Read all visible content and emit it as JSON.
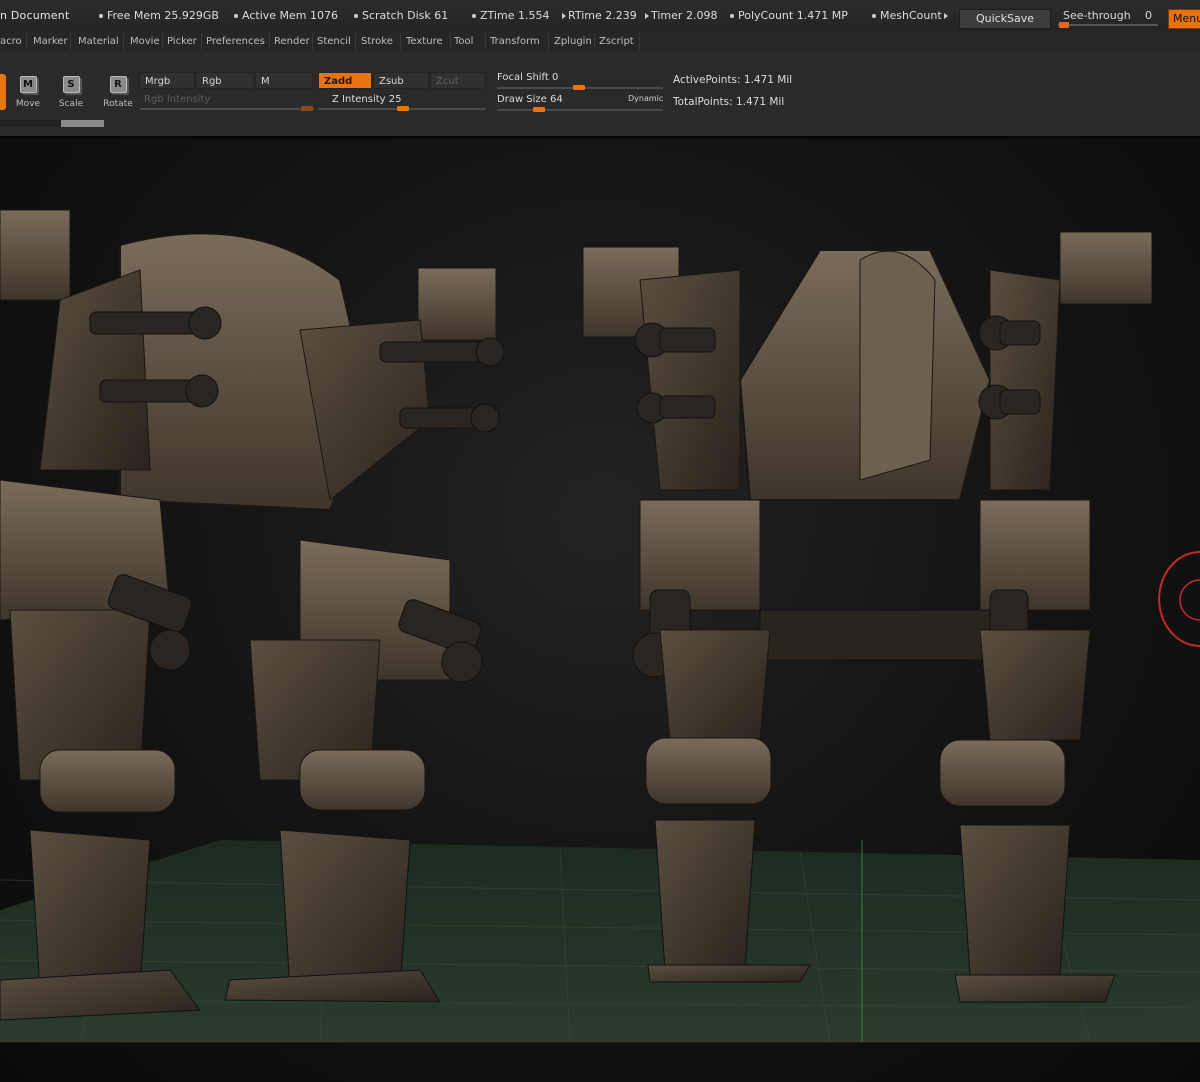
{
  "status": {
    "title_fragment": "n Document",
    "items": [
      {
        "label": "Free Mem",
        "value": "25.929GB",
        "marker": "dot"
      },
      {
        "label": "Active Mem",
        "value": "1076",
        "marker": "dot"
      },
      {
        "label": "Scratch Disk",
        "value": "61",
        "marker": "dot"
      },
      {
        "label": "ZTime",
        "value": "1.554",
        "marker": "dot"
      },
      {
        "label": "RTime",
        "value": "2.239",
        "marker": "tri"
      },
      {
        "label": "Timer",
        "value": "2.098",
        "marker": "tri"
      },
      {
        "label": "PolyCount",
        "value": "1.471 MP",
        "marker": "dot"
      },
      {
        "label": "MeshCount",
        "value": "",
        "marker": "dot"
      }
    ],
    "quicksave": "QuickSave",
    "see_through_label": "See-through",
    "see_through_value": "0",
    "menus_label": "Menus"
  },
  "menubar": [
    "acro",
    "Marker",
    "Material",
    "Movie",
    "Picker",
    "Preferences",
    "Render",
    "Stencil",
    "Stroke",
    "Texture",
    "Tool",
    "Transform",
    "Zplugin",
    "Zscript"
  ],
  "shelf": {
    "tools": [
      {
        "key": "M",
        "label": "Move"
      },
      {
        "key": "S",
        "label": "Scale"
      },
      {
        "key": "R",
        "label": "Rotate"
      }
    ],
    "mrgb": "Mrgb",
    "rgb": "Rgb",
    "m": "M",
    "rgb_intensity": "Rgb Intensity",
    "zadd": "Zadd",
    "zsub": "Zsub",
    "zcut": "Zcut",
    "z_intensity_label": "Z Intensity",
    "z_intensity_value": "25",
    "focal_shift_label": "Focal Shift",
    "focal_shift_value": "0",
    "draw_size_label": "Draw Size",
    "draw_size_value": "64",
    "dynamic": "Dynamic",
    "active_points_label": "ActivePoints:",
    "active_points_value": "1.471 Mil",
    "total_points_label": "TotalPoints:",
    "total_points_value": "1.471 Mil"
  },
  "colors": {
    "accent": "#e8730f",
    "panel": "#2a2a2a",
    "mech_body": "#5e5244",
    "floor_grid": "#2c3a2e"
  }
}
